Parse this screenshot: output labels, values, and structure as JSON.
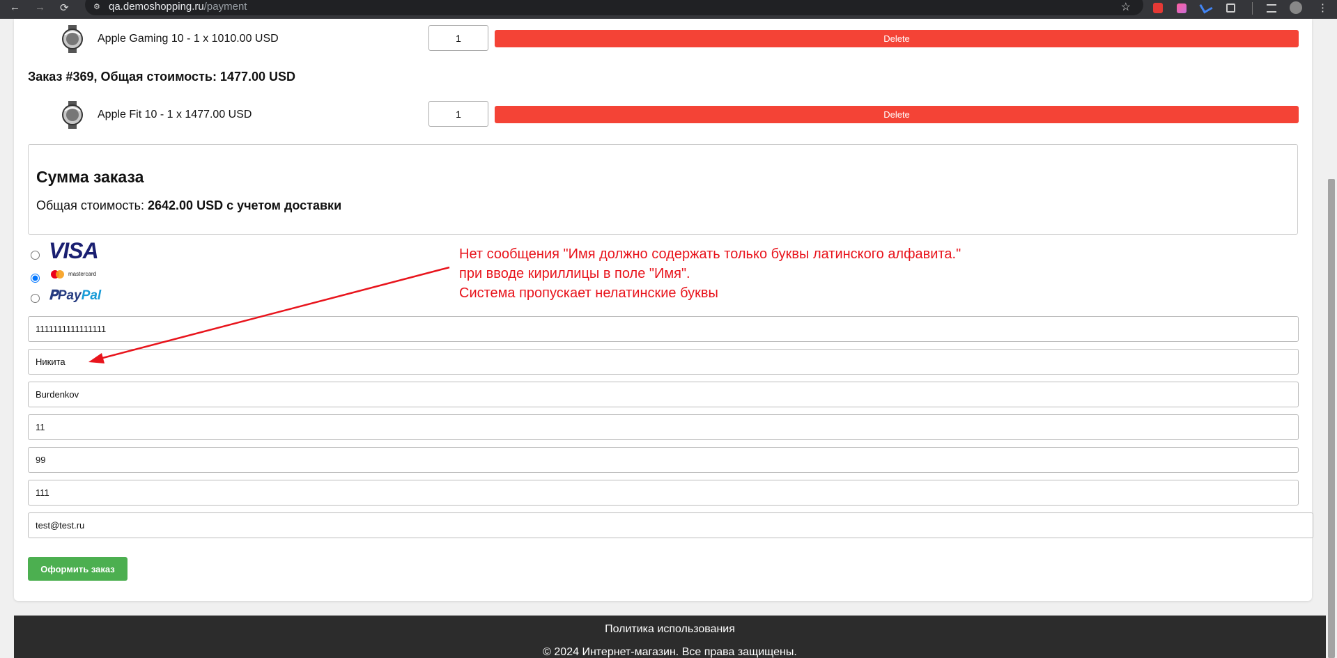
{
  "browser": {
    "back_glyph": "←",
    "forward_glyph": "→",
    "reload_glyph": "⟳",
    "site_glyph": "⚙",
    "url_host": "qa.demoshopping.ru",
    "url_path": "/payment",
    "star_glyph": "☆",
    "menu_glyph": "⋮"
  },
  "items": [
    {
      "label": "Apple Gaming 10 - 1 x 1010.00 USD",
      "qty": "1",
      "delete_label": "Delete"
    },
    {
      "label": "Apple Fit 10 - 1 x 1477.00 USD",
      "qty": "1",
      "delete_label": "Delete"
    }
  ],
  "order_heading": "Заказ #369, Общая стоимость: 1477.00 USD",
  "summary": {
    "title": "Сумма заказа",
    "total_prefix": "Общая стоимость: ",
    "total_value": "2642.00 USD с учетом доставки"
  },
  "payment": {
    "visa": "VISA",
    "mastercard": "mastercard",
    "paypal_1": "Pay",
    "paypal_2": "Pal",
    "selected": "mastercard"
  },
  "form": {
    "card_number": "1111111111111111",
    "first_name": "Никита",
    "last_name": "Burdenkov",
    "month": "11",
    "year": "99",
    "cvv": "111",
    "email": "test@test.ru",
    "submit_label": "Оформить заказ"
  },
  "annotation": {
    "line1": "Нет сообщения \"Имя должно содержать только буквы латинского алфавита.\"",
    "line2": "при вводе кириллицы в поле \"Имя\".",
    "line3": "Система пропускает нелатинские буквы",
    "color": "#e8141c"
  },
  "footer": {
    "policy": "Политика использования",
    "copyright": "© 2024 Интернет-магазин. Все права защищены."
  },
  "colors": {
    "delete": "#f44336",
    "submit": "#4caf50",
    "footer": "#2c2c2c"
  }
}
